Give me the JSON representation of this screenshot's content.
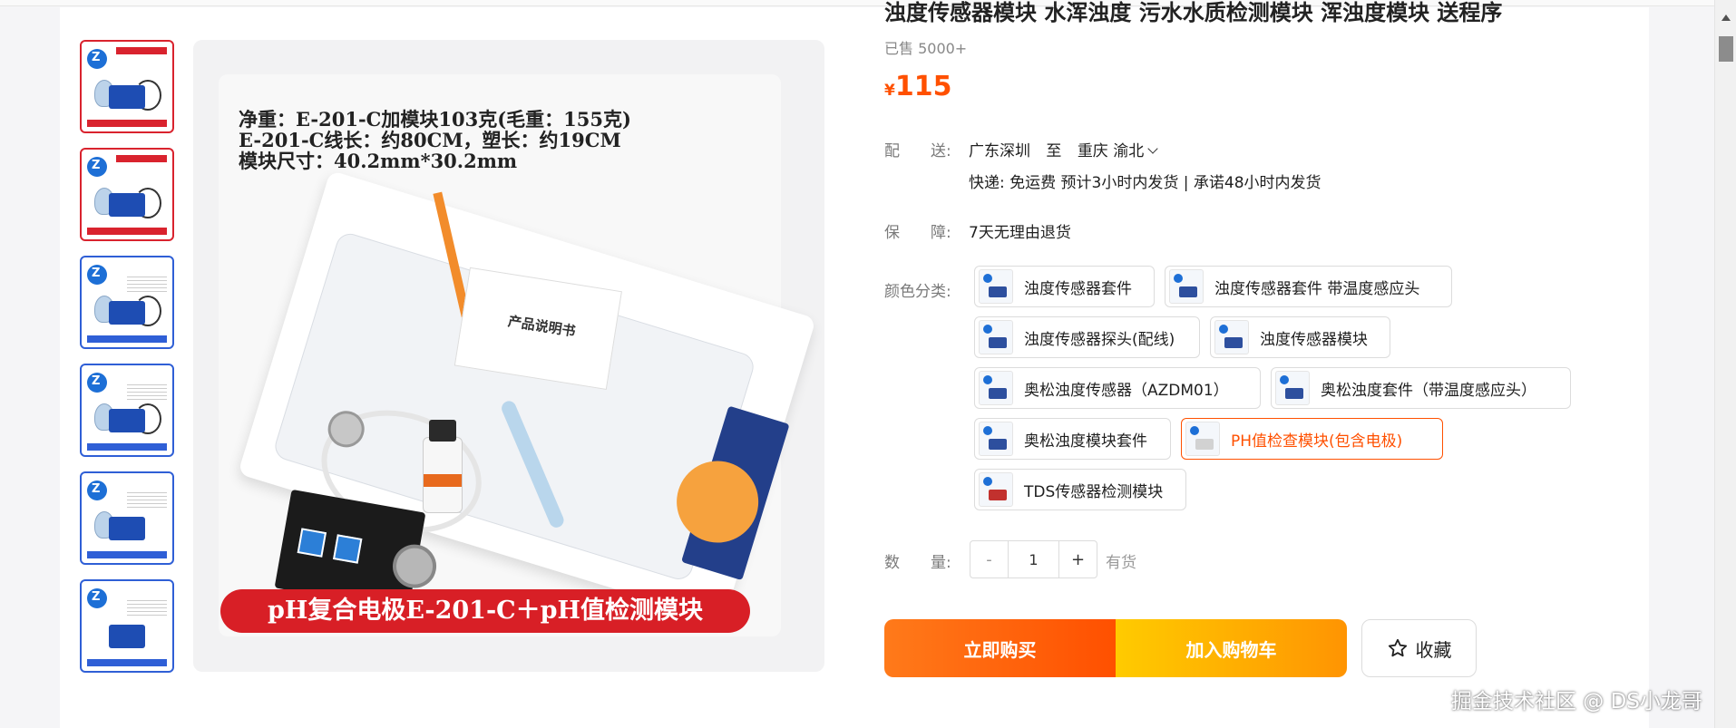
{
  "product": {
    "title": "浊度传感器模块 水浑浊度 污水水质检测模块 浑浊度模块 送程序",
    "sold": "已售 5000+",
    "price_symbol": "¥",
    "price": "115"
  },
  "shipping": {
    "label": "配　　送:",
    "from": "广东深圳",
    "to_word": "至",
    "to": "重庆 渝北",
    "detail": "快递: 免运费   预计3小时内发货 | 承诺48小时内发货"
  },
  "guarantee": {
    "label": "保　　障:",
    "value": "7天无理由退货"
  },
  "options": {
    "label": "颜色分类:",
    "items": [
      {
        "label": "浊度传感器套件",
        "selected": false
      },
      {
        "label": "浊度传感器套件 带温度感应头",
        "selected": false
      },
      {
        "label": "浊度传感器探头(配线)",
        "selected": false
      },
      {
        "label": "浊度传感器模块",
        "selected": false
      },
      {
        "label": "奥松浊度传感器（AZDM01）",
        "selected": false
      },
      {
        "label": "奥松浊度套件（带温度感应头）",
        "selected": false
      },
      {
        "label": "奥松浊度模块套件",
        "selected": false
      },
      {
        "label": "PH值检查模块(包含电极)",
        "selected": true
      },
      {
        "label": "TDS传感器检测模块",
        "selected": false
      }
    ]
  },
  "quantity": {
    "label": "数　　量:",
    "minus": "-",
    "value": "1",
    "plus": "+",
    "stock": "有货"
  },
  "actions": {
    "buy": "立即购买",
    "cart": "加入购物车",
    "favorite": "收藏"
  },
  "image": {
    "spec_line1": "净重：E-201-C加模块103克(毛重：155克)",
    "spec_line2": "E-201-C线长：约80CM，塑长：约19CM",
    "spec_line3": "模块尺寸：40.2mm*30.2mm",
    "manual": "产品说明书",
    "banner": "pH复合电极E-201-C＋pH值检测模块"
  },
  "watermark": "掘金技术社区 @ DS小龙哥",
  "colors": {
    "accent": "#ff5000",
    "buy_gradient": [
      "#ff7a1a",
      "#ff5000"
    ],
    "cart_gradient": [
      "#ffcb00",
      "#ff9402"
    ]
  }
}
